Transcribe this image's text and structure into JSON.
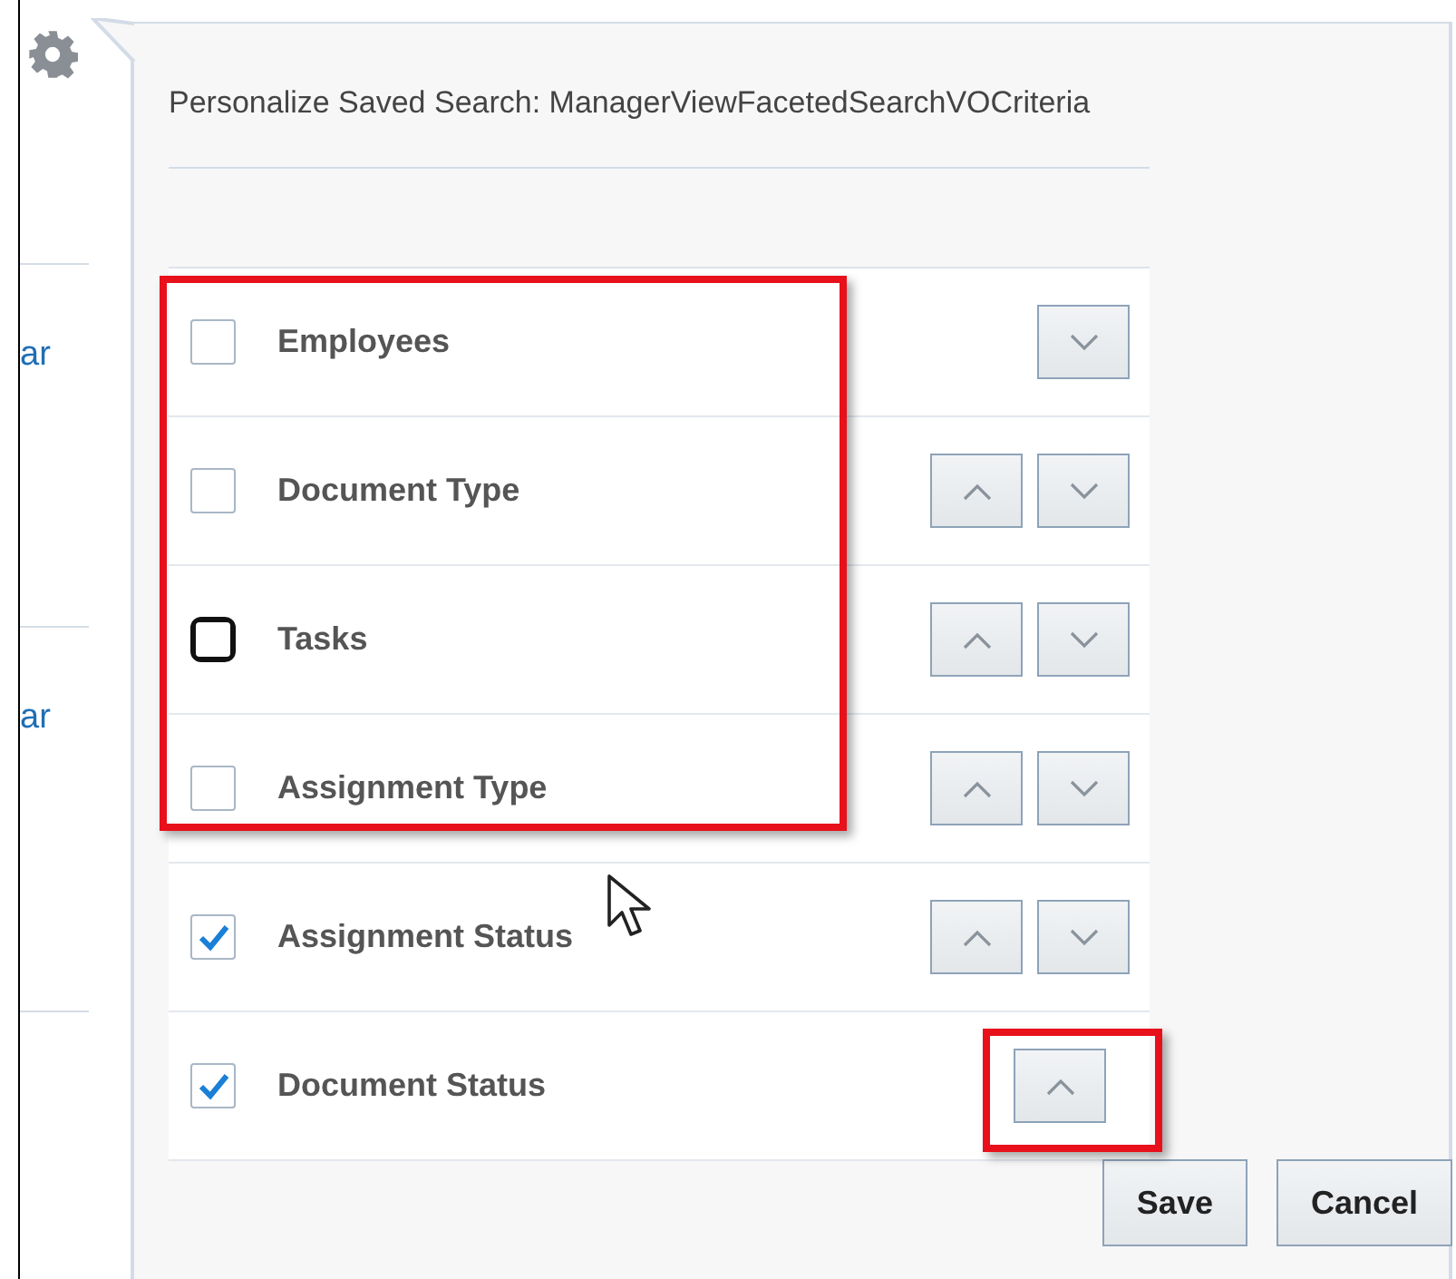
{
  "background": {
    "links": [
      "ar",
      "ar"
    ]
  },
  "dialog": {
    "title": "Personalize Saved Search: ManagerViewFacetedSearchVOCriteria",
    "items": [
      {
        "label": "Employees",
        "checked": false,
        "focused": false,
        "highlighted": true,
        "buttons": [
          {
            "kind": "down",
            "highlighted": false
          }
        ]
      },
      {
        "label": "Document Type",
        "checked": false,
        "focused": false,
        "highlighted": true,
        "buttons": [
          {
            "kind": "up",
            "highlighted": false
          },
          {
            "kind": "down",
            "highlighted": false
          }
        ]
      },
      {
        "label": "Tasks",
        "checked": false,
        "focused": true,
        "highlighted": true,
        "buttons": [
          {
            "kind": "up",
            "highlighted": false
          },
          {
            "kind": "down",
            "highlighted": false
          }
        ]
      },
      {
        "label": "Assignment Type",
        "checked": false,
        "focused": false,
        "highlighted": true,
        "buttons": [
          {
            "kind": "up",
            "highlighted": false
          },
          {
            "kind": "down",
            "highlighted": false
          }
        ]
      },
      {
        "label": "Assignment Status",
        "checked": true,
        "focused": false,
        "highlighted": false,
        "buttons": [
          {
            "kind": "up",
            "highlighted": false
          },
          {
            "kind": "down",
            "highlighted": false
          }
        ]
      },
      {
        "label": "Document Status",
        "checked": true,
        "focused": false,
        "highlighted": false,
        "buttons": [
          {
            "kind": "up",
            "highlighted": true
          }
        ]
      }
    ],
    "actions": [
      "Save",
      "Cancel"
    ]
  }
}
